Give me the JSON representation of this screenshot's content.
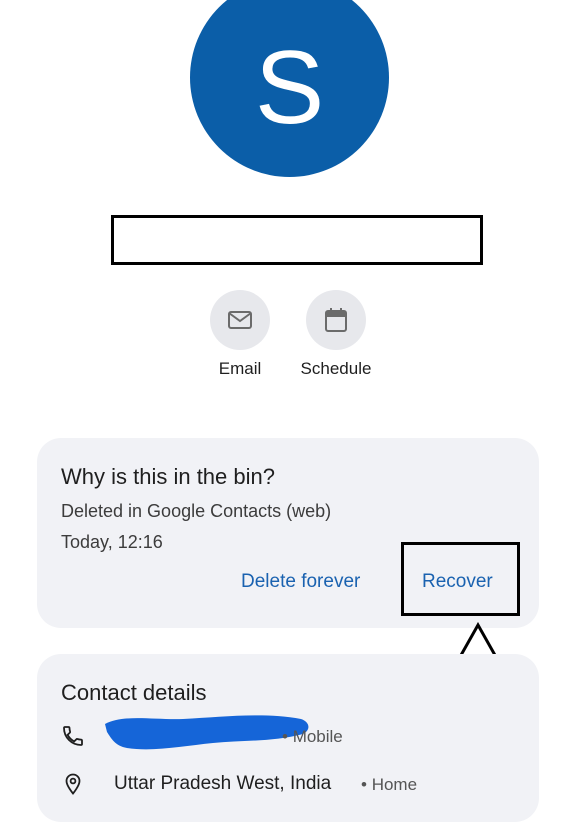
{
  "contact": {
    "avatar_letter": "S",
    "avatar_color": "#0b5ea8"
  },
  "quick_actions": [
    {
      "label": "Email",
      "icon": "mail-icon"
    },
    {
      "label": "Schedule",
      "icon": "calendar-icon"
    }
  ],
  "bin_info": {
    "title": "Why is this in the bin?",
    "reason": "Deleted in Google Contacts (web)",
    "time": "Today, 12:16",
    "delete_label": "Delete forever",
    "recover_label": "Recover"
  },
  "contact_details": {
    "title": "Contact details",
    "phone": {
      "icon": "phone-icon",
      "type": "Mobile"
    },
    "address": {
      "icon": "location-pin-icon",
      "value": "Uttar Pradesh West, India",
      "type": "Home"
    }
  },
  "colors": {
    "accent": "#1a62b0",
    "card_bg": "#f1f2f6",
    "redaction": "#1565d8"
  }
}
